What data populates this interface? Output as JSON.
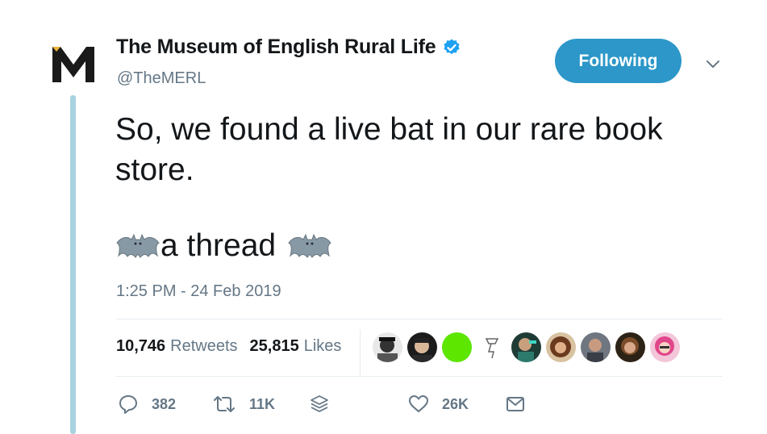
{
  "account": {
    "display_name": "The Museum of English Rural Life",
    "handle": "@TheMERL",
    "verified": true,
    "logo_letter": "M"
  },
  "follow_button": {
    "label": "Following",
    "color": "#2c97c8"
  },
  "tweet": {
    "text_line1": "So, we found a live bat in our rare book store.",
    "thread_text": "a thread",
    "emoji": "bat",
    "timestamp": "1:25 PM - 24 Feb 2019"
  },
  "stats": {
    "retweets_count": "10,746",
    "retweets_label": "Retweets",
    "likes_count": "25,815",
    "likes_label": "Likes",
    "liker_avatars": [
      "avatar-1",
      "avatar-2",
      "avatar-3",
      "avatar-4",
      "avatar-5",
      "avatar-6",
      "avatar-7",
      "avatar-8",
      "avatar-9"
    ]
  },
  "actions": {
    "reply_count": "382",
    "retweet_count": "11K",
    "like_count": "26K"
  },
  "colors": {
    "accent": "#1da1f2",
    "muted": "#657786",
    "thread_line": "#a8d3e0",
    "text": "#14171a"
  }
}
